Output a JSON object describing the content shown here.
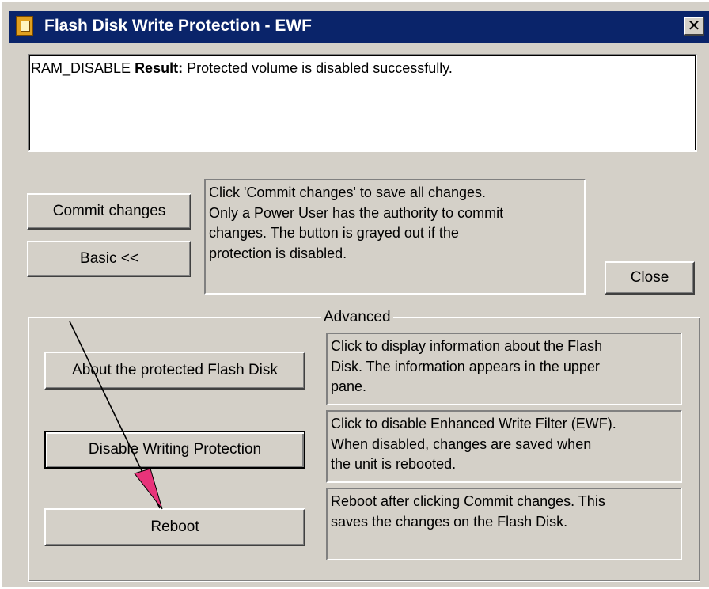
{
  "window": {
    "title": "Flash Disk Write Protection - EWF",
    "close_label": "✕"
  },
  "result": {
    "prefix": "RAM_DISABLE",
    "label": "Result:",
    "message": "Protected volume is disabled successfully."
  },
  "buttons": {
    "commit": "Commit changes",
    "basic": "Basic <<",
    "close": "Close",
    "about": "About the protected Flash Disk",
    "disable": "Disable Writing Protection",
    "reboot": "Reboot"
  },
  "help": {
    "commit": [
      "Click 'Commit changes' to save all changes.",
      "Only a Power User has the authority to commit",
      "changes. The button is grayed out if the",
      "protection is disabled."
    ],
    "about": [
      "Click to display information about the Flash",
      "Disk. The information appears in the upper",
      "pane."
    ],
    "disable": [
      "Click to disable Enhanced Write Filter (EWF).",
      "When disabled, changes are saved when",
      "the unit is rebooted."
    ],
    "reboot": [
      "Reboot after clicking Commit changes. This",
      "saves the changes on the Flash Disk."
    ]
  },
  "advanced_group": {
    "label": "Advanced"
  },
  "icons": {
    "app": "app-window-icon",
    "pointer": "annotation-arrow"
  },
  "colors": {
    "titlebar": "#0a246a",
    "face": "#d4d0c8",
    "arrow_head": "#e8337a"
  }
}
